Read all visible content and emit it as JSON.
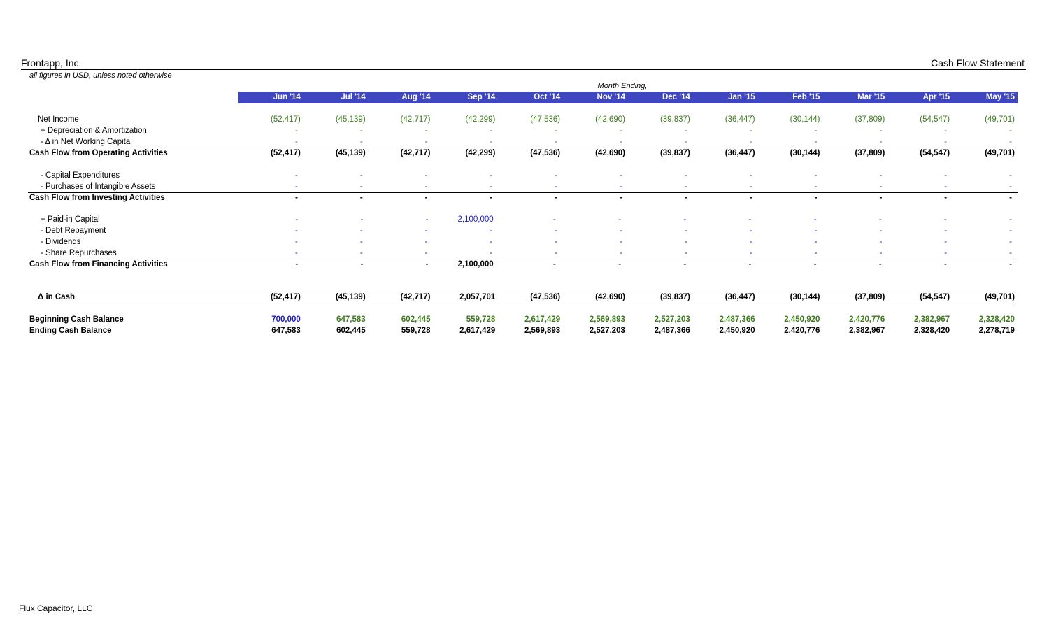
{
  "header": {
    "company": "Frontapp, Inc.",
    "statement": "Cash Flow Statement",
    "units_note": "all figures in USD, unless noted otherwise",
    "period_label": "Month Ending,"
  },
  "months": [
    "Jun '14",
    "Jul '14",
    "Aug '14",
    "Sep '14",
    "Oct '14",
    "Nov '14",
    "Dec '14",
    "Jan '15",
    "Feb '15",
    "Mar '15",
    "Apr '15",
    "May '15"
  ],
  "colors": {
    "header_bar": "#3f47c0",
    "formula_green": "#3d7a1b",
    "input_blue": "#1a1acc"
  },
  "rows": {
    "net_income": {
      "label": "Net Income",
      "values": [
        "(52,417)",
        "(45,139)",
        "(42,717)",
        "(42,299)",
        "(47,536)",
        "(42,690)",
        "(39,837)",
        "(36,447)",
        "(30,144)",
        "(37,809)",
        "(54,547)",
        "(49,701)"
      ]
    },
    "dep_amort": {
      "label": "+ Depreciation & Amortization",
      "values": [
        "-",
        "-",
        "-",
        "-",
        "-",
        "-",
        "-",
        "-",
        "-",
        "-",
        "-",
        "-"
      ]
    },
    "nwc": {
      "label": "- Δ in Net Working Capital",
      "values": [
        "-",
        "-",
        "-",
        "-",
        "-",
        "-",
        "-",
        "-",
        "-",
        "-",
        "-",
        "-"
      ]
    },
    "cfo": {
      "label": "Cash Flow from Operating Activities",
      "values": [
        "(52,417)",
        "(45,139)",
        "(42,717)",
        "(42,299)",
        "(47,536)",
        "(42,690)",
        "(39,837)",
        "(36,447)",
        "(30,144)",
        "(37,809)",
        "(54,547)",
        "(49,701)"
      ]
    },
    "capex": {
      "label": "- Capital Expenditures",
      "values": [
        "-",
        "-",
        "-",
        "-",
        "-",
        "-",
        "-",
        "-",
        "-",
        "-",
        "-",
        "-"
      ]
    },
    "intangibles": {
      "label": "- Purchases of Intangible Assets",
      "values": [
        "-",
        "-",
        "-",
        "-",
        "-",
        "-",
        "-",
        "-",
        "-",
        "-",
        "-",
        "-"
      ]
    },
    "cfi": {
      "label": "Cash Flow from Investing Activities",
      "values": [
        "-",
        "-",
        "-",
        "-",
        "-",
        "-",
        "-",
        "-",
        "-",
        "-",
        "-",
        "-"
      ]
    },
    "paid_in": {
      "label": "+ Paid-in Capital",
      "values": [
        "-",
        "-",
        "-",
        "2,100,000",
        "-",
        "-",
        "-",
        "-",
        "-",
        "-",
        "-",
        "-"
      ]
    },
    "debt_repay": {
      "label": "- Debt Repayment",
      "values": [
        "-",
        "-",
        "-",
        "-",
        "-",
        "-",
        "-",
        "-",
        "-",
        "-",
        "-",
        "-"
      ]
    },
    "dividends": {
      "label": "- Dividends",
      "values": [
        "-",
        "-",
        "-",
        "-",
        "-",
        "-",
        "-",
        "-",
        "-",
        "-",
        "-",
        "-"
      ]
    },
    "repurchases": {
      "label": "- Share Repurchases",
      "values": [
        "-",
        "-",
        "-",
        "-",
        "-",
        "-",
        "-",
        "-",
        "-",
        "-",
        "-",
        "-"
      ]
    },
    "cff": {
      "label": "Cash Flow from Financing Activities",
      "values": [
        "-",
        "-",
        "-",
        "2,100,000",
        "-",
        "-",
        "-",
        "-",
        "-",
        "-",
        "-",
        "-"
      ]
    },
    "delta_cash": {
      "label": "Δ in Cash",
      "values": [
        "(52,417)",
        "(45,139)",
        "(42,717)",
        "2,057,701",
        "(47,536)",
        "(42,690)",
        "(39,837)",
        "(36,447)",
        "(30,144)",
        "(37,809)",
        "(54,547)",
        "(49,701)"
      ]
    },
    "begin_cash": {
      "label": "Beginning Cash Balance",
      "values": [
        "700,000",
        "647,583",
        "602,445",
        "559,728",
        "2,617,429",
        "2,569,893",
        "2,527,203",
        "2,487,366",
        "2,450,920",
        "2,420,776",
        "2,382,967",
        "2,328,420"
      ]
    },
    "end_cash": {
      "label": "Ending Cash Balance",
      "values": [
        "647,583",
        "602,445",
        "559,728",
        "2,617,429",
        "2,569,893",
        "2,527,203",
        "2,487,366",
        "2,450,920",
        "2,420,776",
        "2,382,967",
        "2,328,420",
        "2,278,719"
      ]
    }
  },
  "footer": {
    "preparer": "Flux Capacitor, LLC"
  }
}
